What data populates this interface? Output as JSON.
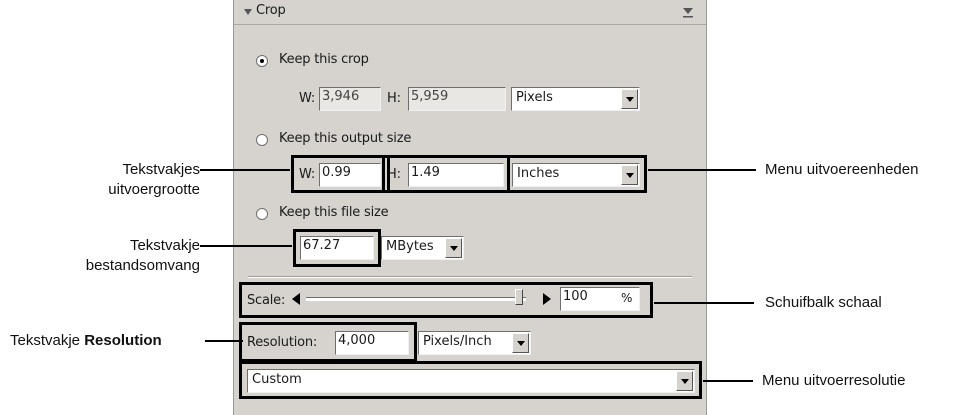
{
  "panel": {
    "title": "Crop",
    "keep_crop": {
      "label": "Keep this crop",
      "w_label": "W:",
      "w_value": "3,946",
      "h_label": "H:",
      "h_value": "5,959",
      "unit": "Pixels"
    },
    "keep_output": {
      "label": "Keep this output size",
      "w_label": "W:",
      "w_value": "0.99",
      "h_label": "H:",
      "h_value": "1.49",
      "unit": "Inches"
    },
    "keep_file": {
      "label": "Keep this file size",
      "value": "67.27",
      "unit": "MBytes"
    },
    "scale": {
      "label": "Scale:",
      "value": "100",
      "percent": "%",
      "slider_fraction": 0.97
    },
    "resolution": {
      "label": "Resolution:",
      "value": "4,000",
      "unit": "Pixels/Inch"
    },
    "output_resolution": {
      "value": "Custom"
    }
  },
  "annotations": {
    "output_size_fields": [
      "Tekstvakjes",
      "uitvoergrootte"
    ],
    "file_size_field": [
      "Tekstvakje",
      "bestandsomvang"
    ],
    "resolution_field": {
      "prefix": "Tekstvakje ",
      "bold": "Resolution"
    },
    "output_units_menu": "Menu uitvoereenheden",
    "scale_slider": "Schuifbalk schaal",
    "output_resolution_menu": "Menu uitvoerresolutie"
  }
}
